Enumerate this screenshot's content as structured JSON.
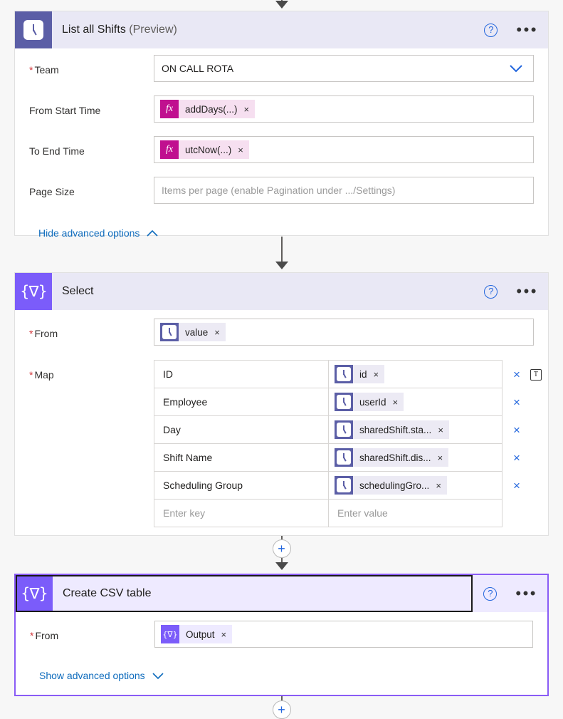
{
  "connectors": {
    "top_arrow": "arrow-down",
    "mid_arrow": "arrow-down",
    "add_step_label": "+",
    "bottom_add_label": "+"
  },
  "cards": [
    {
      "id": "list-all-shifts",
      "icon": "shifts-clock-icon",
      "title": "List all Shifts",
      "title_suffix": "(Preview)",
      "help_label": "?",
      "more_label": "•••",
      "fields": [
        {
          "label": "Team",
          "required": true,
          "type": "dropdown",
          "value": "ON CALL ROTA",
          "chevron": "chevron-down-icon"
        },
        {
          "label": "From Start Time",
          "required": false,
          "type": "expression",
          "chip_icon": "fx",
          "chip_text": "addDays(...)",
          "chip_remove": "×"
        },
        {
          "label": "To End Time",
          "required": false,
          "type": "expression",
          "chip_icon": "fx",
          "chip_text": "utcNow(...)",
          "chip_remove": "×"
        },
        {
          "label": "Page Size",
          "required": false,
          "type": "text",
          "placeholder": "Items per page (enable Pagination under .../Settings)"
        }
      ],
      "advanced": {
        "label": "Hide advanced options",
        "caret": "∧"
      }
    },
    {
      "id": "select",
      "icon": "select-braces-icon",
      "icon_glyph": "{∇}",
      "title": "Select",
      "help_label": "?",
      "more_label": "•••",
      "from": {
        "label": "From",
        "required": true,
        "chip_text": "value",
        "chip_remove": "×"
      },
      "map": {
        "label": "Map",
        "required": true,
        "rows": [
          {
            "key": "ID",
            "value": "id",
            "remove": "×",
            "has_text_mode": true
          },
          {
            "key": "Employee",
            "value": "userId",
            "remove": "×",
            "has_text_mode": false
          },
          {
            "key": "Day",
            "value": "sharedShift.sta...",
            "remove": "×",
            "has_text_mode": false
          },
          {
            "key": "Shift Name",
            "value": "sharedShift.dis...",
            "remove": "×",
            "has_text_mode": false
          },
          {
            "key": "Scheduling Group",
            "value": "schedulingGro...",
            "remove": "×",
            "has_text_mode": false
          }
        ],
        "empty_row": {
          "key_placeholder": "Enter key",
          "value_placeholder": "Enter value"
        }
      }
    },
    {
      "id": "create-csv-table",
      "icon": "select-braces-icon",
      "icon_glyph": "{∇}",
      "title": "Create CSV table",
      "selected": true,
      "help_label": "?",
      "more_label": "•••",
      "from": {
        "label": "From",
        "required": true,
        "chip_icon_glyph": "{∇}",
        "chip_text": "Output",
        "chip_remove": "×"
      },
      "advanced": {
        "label": "Show advanced options",
        "caret": "∨"
      }
    }
  ],
  "colors": {
    "shifts_tile": "#5b5ea6",
    "select_tile": "#7b5cfa",
    "header_bg": "#e9e8f5",
    "selected_border": "#8a5cf6",
    "link_blue": "#0f6cbd",
    "expr_magenta": "#c0108f",
    "required_red": "#d13438"
  }
}
